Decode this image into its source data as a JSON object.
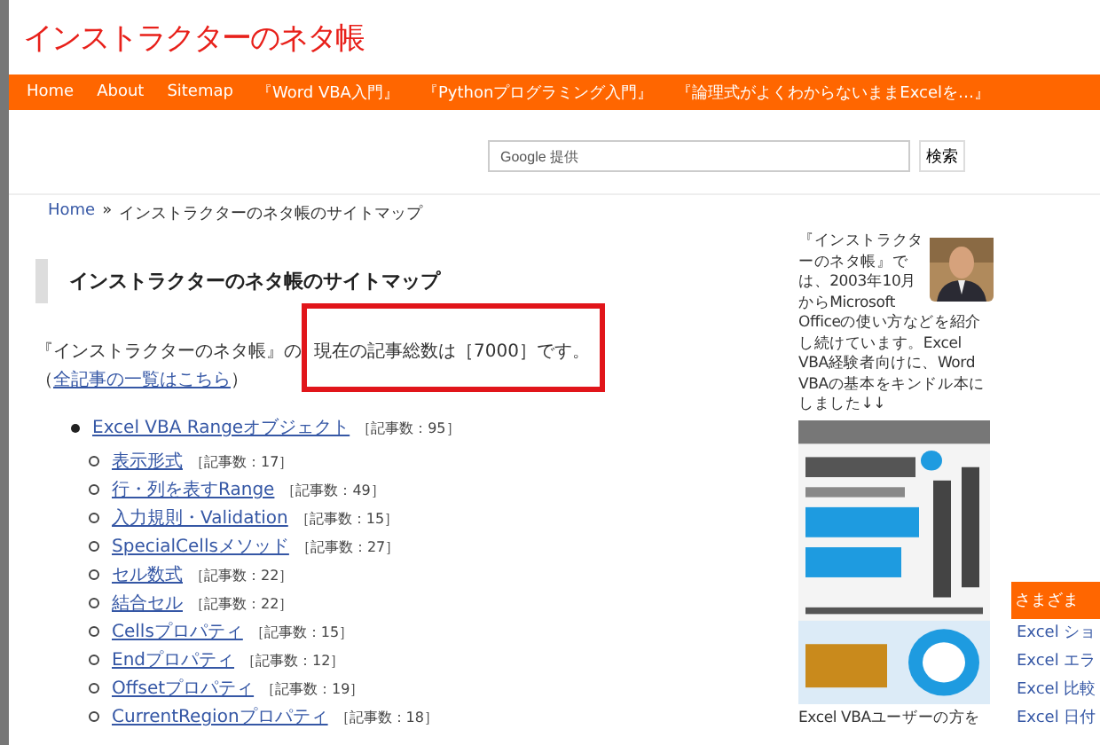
{
  "site_title": "インストラクターのネタ帳",
  "nav": [
    "Home",
    "About",
    "Sitemap",
    "『Word VBA入門』",
    "『Pythonプログラミング入門』",
    "『論理式がよくわからないままExcelを…』"
  ],
  "search": {
    "placeholder": "Google 提供",
    "button": "検索"
  },
  "breadcrumb": {
    "home": "Home",
    "separator": "»",
    "current": "インストラクターのネタ帳のサイトマップ"
  },
  "heading": "インストラクターのネタ帳のサイトマップ",
  "intro": {
    "text": "『インストラクターのネタ帳』の",
    "highlight": "現在の記事総数は［7000］です。",
    "open": "（",
    "link": "全記事の一覧はこちら",
    "close": "）"
  },
  "categories": [
    {
      "name": "Excel VBA Rangeオブジェクト",
      "count": "［記事数：95］",
      "children": [
        {
          "name": "表示形式",
          "count": "［記事数：17］"
        },
        {
          "name": "行・列を表すRange",
          "count": "［記事数：49］"
        },
        {
          "name": "入力規則・Validation",
          "count": "［記事数：15］"
        },
        {
          "name": "SpecialCellsメソッド",
          "count": "［記事数：27］"
        },
        {
          "name": "セル数式",
          "count": "［記事数：22］"
        },
        {
          "name": "結合セル",
          "count": "［記事数：22］"
        },
        {
          "name": "Cellsプロパティ",
          "count": "［記事数：15］"
        },
        {
          "name": "Endプロパティ",
          "count": "［記事数：12］"
        },
        {
          "name": "Offsetプロパティ",
          "count": "［記事数：19］"
        },
        {
          "name": "CurrentRegionプロパティ",
          "count": "［記事数：18］"
        }
      ]
    }
  ],
  "sidebar": {
    "profile_top": "『インストラクターのネタ帳』では、2003年10月からMicrosoft",
    "profile_bottom": "Officeの使い方などを紹介し続けています。Excel VBA経験者向けに、Word VBAの基本をキンドル本にしました↓↓",
    "caption": "Excel VBAユーザーの方を"
  },
  "widget": {
    "title": "さまざま",
    "links": [
      "Excel ショ",
      "Excel エラ",
      "Excel 比較",
      "Excel 日付"
    ]
  }
}
